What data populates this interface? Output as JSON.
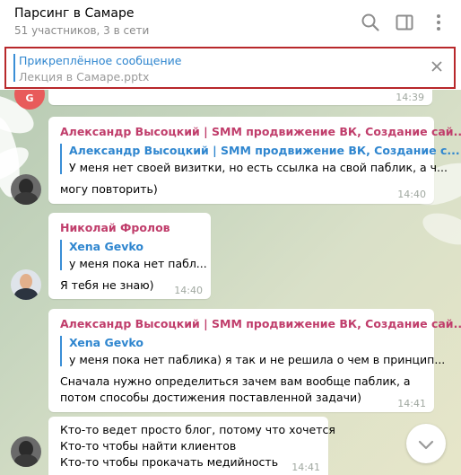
{
  "header": {
    "title": "Парсинг в Самаре",
    "subtitle": "51 участников, 3 в сети"
  },
  "pinned": {
    "title": "Прикреплённое сообщение",
    "text": "Лекция в Самаре.pptx"
  },
  "avatar_letter": "G",
  "messages": [
    {
      "time": "14:39"
    },
    {
      "sender": "Александр Высоцкий | SMM продвижение ВК, Создание сай...",
      "quote_name": "Александр Высоцкий | SMM продвижение ВК, Создание с...",
      "quote_text": "У меня нет своей визитки, но есть ссылка на свой паблик, а ч...",
      "text": [
        "могу повторить)"
      ],
      "time": "14:40"
    },
    {
      "sender": "Николай Фролов",
      "quote_name": "Xena Gevko",
      "quote_text": "у меня пока нет пабл...",
      "text": [
        "Я тебя не знаю)"
      ],
      "time": "14:40"
    },
    {
      "sender": "Александр Высоцкий | SMM продвижение ВК, Создание сай...",
      "quote_name": "Xena Gevko",
      "quote_text": "у меня пока нет паблика) я так и не решила о чем в принцип...",
      "text": [
        "Сначала нужно определиться зачем вам вообще паблик, а",
        "потом способы достижения поставленной задачи)"
      ],
      "time": "14:41"
    },
    {
      "text": [
        "Кто-то ведет просто блог, потому что хочется",
        "Кто-то чтобы найти клиентов",
        "Кто-то чтобы прокачать медийность"
      ],
      "time": "14:41"
    }
  ],
  "colors": {
    "accent": "#3a8ed6",
    "sender": "#c03d6b",
    "highlight_border": "#b8282b"
  },
  "icons": [
    "search-icon",
    "sidebar-icon",
    "more-icon",
    "close-icon",
    "chevron-down-icon"
  ]
}
